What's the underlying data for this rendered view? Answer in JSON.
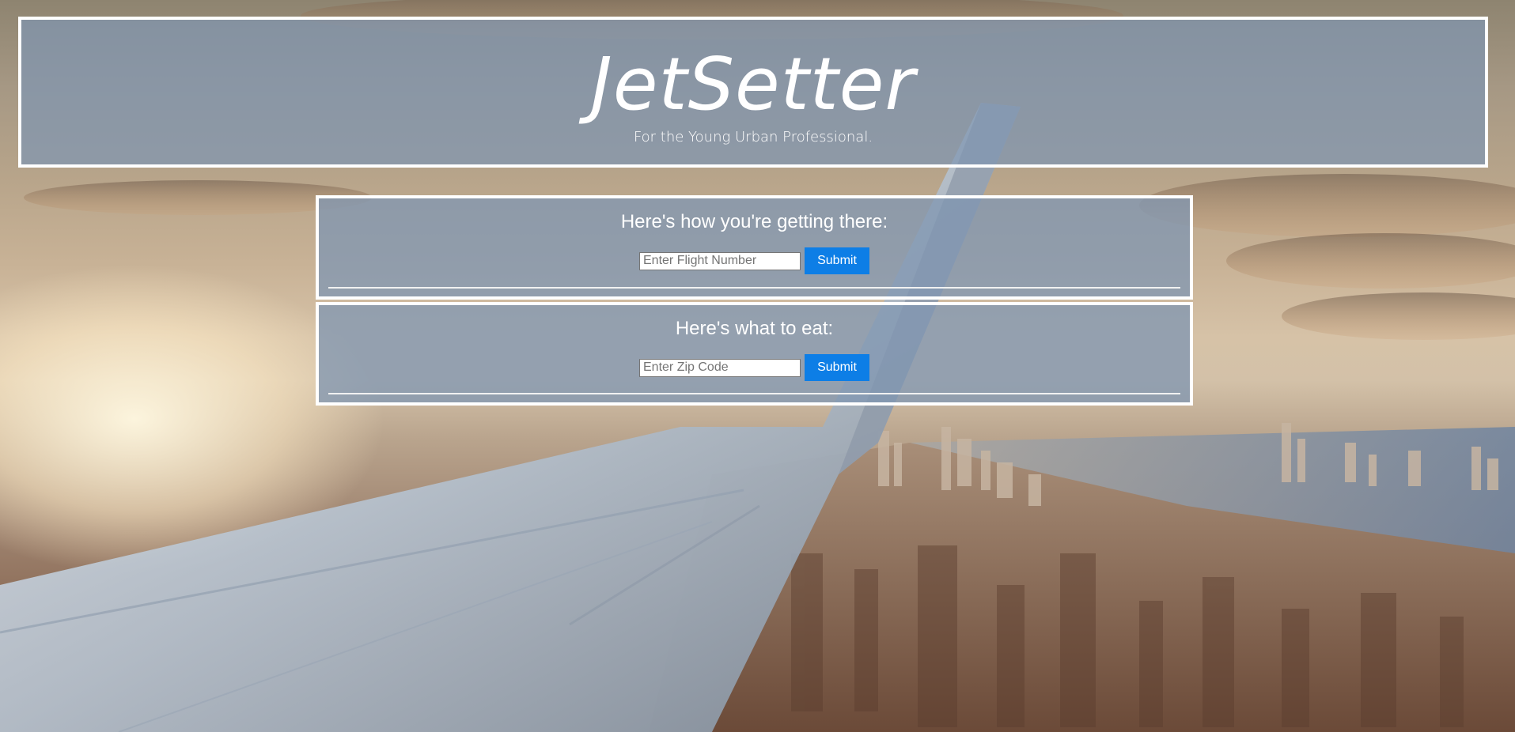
{
  "header": {
    "title": "JetSetter",
    "tagline": "For the Young Urban Professional."
  },
  "flight_section": {
    "heading": "Here's how you're getting there:",
    "input_placeholder": "Enter Flight Number",
    "submit_label": "Submit"
  },
  "food_section": {
    "heading": "Here's what to eat:",
    "input_placeholder": "Enter Zip Code",
    "submit_label": "Submit"
  },
  "colors": {
    "panel_overlay": "#8096b2",
    "button": "#0d7ee6",
    "border": "#ffffff"
  }
}
